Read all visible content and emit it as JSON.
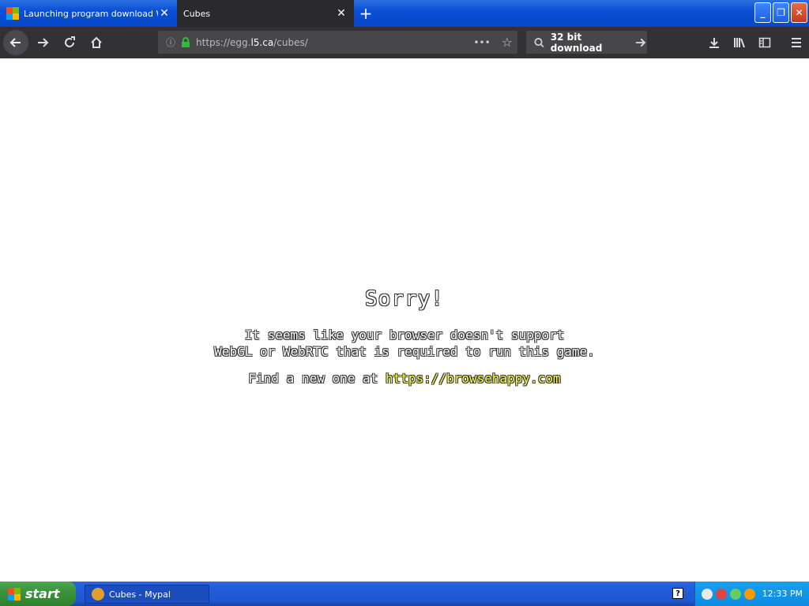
{
  "browser": {
    "tabs": [
      {
        "label": "Launching program download Win",
        "active": false
      },
      {
        "label": "Cubes",
        "active": true
      }
    ],
    "url_prefix": "https://egg.",
    "url_domain": "l5.ca",
    "url_path": "/cubes/",
    "search_value": "32 bit download"
  },
  "page": {
    "heading": "Sorry!",
    "line1": "It seems like your browser doesn't support",
    "line2": "WebGL or WebRTC that is required to run this game.",
    "find_prefix": "Find a new one at ",
    "find_link": "https://browsehappy.com"
  },
  "taskbar": {
    "start_label": "start",
    "task_label": "Cubes - Mypal",
    "help_label": "?",
    "clock": "12:33 PM"
  }
}
